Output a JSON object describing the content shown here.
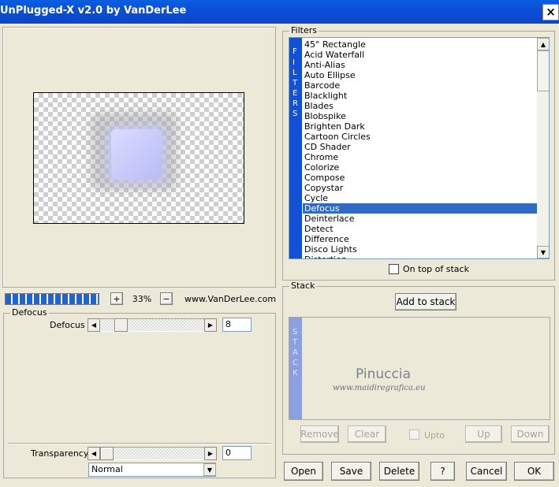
{
  "window": {
    "title": "UnPlugged-X v2.0 by VanDerLee",
    "close_label": "×"
  },
  "preview": {
    "zoom_minus": "−",
    "zoom_plus": "+",
    "zoom_value": "33%",
    "website": "www.VanDerLee.com",
    "progress_fraction": 1.0
  },
  "filters": {
    "group_title": "Filters",
    "vertical_label": [
      "F",
      "I",
      "L",
      "T",
      "E",
      "R",
      "S"
    ],
    "items": [
      "45° Rectangle",
      "Acid Waterfall",
      "Anti-Alias",
      "Auto Ellipse",
      "Barcode",
      "Blacklight",
      "Blades",
      "Blobspike",
      "Brighten Dark",
      "Cartoon Circles",
      "CD Shader",
      "Chrome",
      "Colorize",
      "Compose",
      "Copystar",
      "Cycle",
      "Defocus",
      "Deinterlace",
      "Detect",
      "Difference",
      "Disco Lights",
      "Distortion"
    ],
    "selected": "Defocus",
    "on_top_label": "On top of stack"
  },
  "parameters": {
    "group_title": "Defocus",
    "defocus_label": "Defocus",
    "defocus_value": "8",
    "transparency_label": "Transparency",
    "transparency_value": "0",
    "blend_mode": "Normal"
  },
  "stack": {
    "group_title": "Stack",
    "add_label": "Add to stack",
    "vertical_label": [
      "S",
      "T",
      "A",
      "C",
      "K"
    ],
    "watermark_name": "Pinuccia",
    "watermark_url": "www.maidiregrafica.eu",
    "remove_label": "Remove",
    "clear_label": "Clear",
    "upto_label": "Upto",
    "up_label": "Up",
    "down_label": "Down"
  },
  "footer": {
    "open_label": "Open",
    "save_label": "Save",
    "delete_label": "Delete",
    "help_label": "?",
    "cancel_label": "Cancel",
    "ok_label": "OK"
  },
  "colors": {
    "titlebar": "#0b4fd6",
    "selection": "#316ac5",
    "filters_bar": "#1250d8",
    "stack_bar": "#8aa0e0",
    "progress": "#1e64d6"
  }
}
